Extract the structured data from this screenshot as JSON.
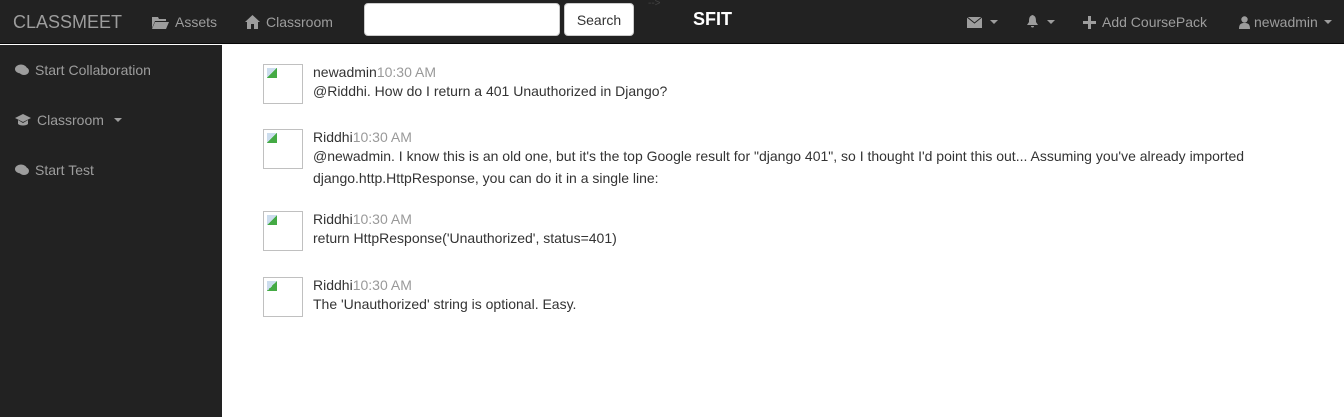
{
  "navbar": {
    "brand": "CLASSMEET",
    "assets": "Assets",
    "classroom": "Classroom",
    "search_placeholder": "",
    "search_button": "Search",
    "comment_arrow": "-->",
    "center_title": "SFIT",
    "add_coursepack": "Add CoursePack",
    "user": "newadmin"
  },
  "sidebar": {
    "items": [
      {
        "label": "Start Collaboration",
        "icon": "comments-icon"
      },
      {
        "label": "Classroom",
        "icon": "graduation-cap-icon"
      },
      {
        "label": "Start Test",
        "icon": "comments-icon"
      }
    ]
  },
  "messages": [
    {
      "author": "newadmin",
      "time": "10:30 AM",
      "text": "@Riddhi. How do I return a 401 Unauthorized in Django?"
    },
    {
      "author": "Riddhi",
      "time": "10:30 AM",
      "text": "@newadmin. I know this is an old one, but it's the top Google result for \"django 401\", so I thought I'd point this out... Assuming you've already imported django.http.HttpResponse, you can do it in a single line:"
    },
    {
      "author": "Riddhi",
      "time": "10:30 AM",
      "text": "return HttpResponse('Unauthorized', status=401)"
    },
    {
      "author": "Riddhi",
      "time": "10:30 AM",
      "text": "The 'Unauthorized' string is optional. Easy."
    }
  ]
}
